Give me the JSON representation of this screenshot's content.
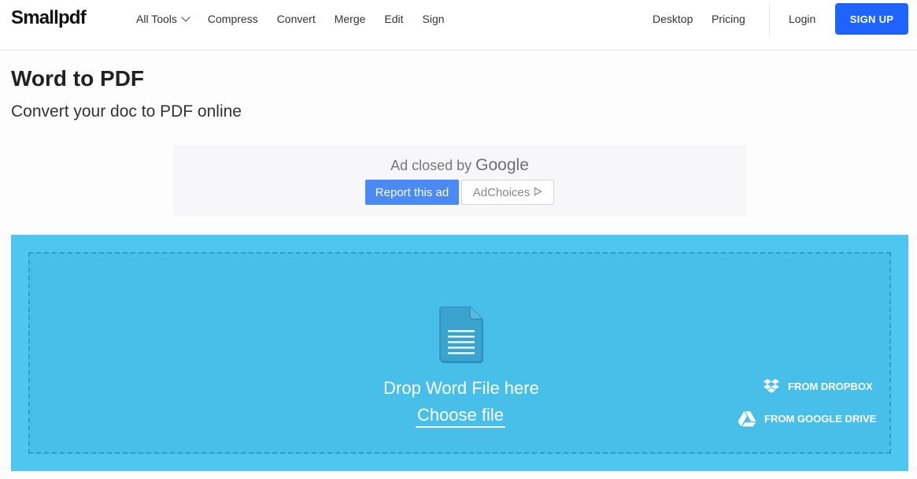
{
  "header": {
    "logo": "Smallpdf",
    "nav": [
      {
        "label": "All Tools",
        "has_dropdown": true
      },
      {
        "label": "Compress"
      },
      {
        "label": "Convert"
      },
      {
        "label": "Merge"
      },
      {
        "label": "Edit"
      },
      {
        "label": "Sign"
      }
    ],
    "desktop": "Desktop",
    "pricing": "Pricing",
    "login": "Login",
    "signup": "SIGN UP"
  },
  "main": {
    "title": "Word to PDF",
    "subtitle": "Convert your doc to PDF online"
  },
  "ad": {
    "closed_text": "Ad closed by",
    "google": "Google",
    "report": "Report this ad",
    "choices": "AdChoices"
  },
  "dropzone": {
    "drop_text": "Drop Word File here",
    "choose": "Choose file",
    "dropbox": "FROM DROPBOX",
    "gdrive": "FROM GOOGLE DRIVE"
  },
  "colors": {
    "accent": "#1f63ff",
    "dropzone_bg": "#4dc6f0",
    "dropzone_inner": "#47bfe9",
    "report_btn": "#4a8af4"
  },
  "icons": [
    "chevron-down-icon",
    "document-icon",
    "dropbox-icon",
    "google-drive-icon",
    "adchoices-icon"
  ]
}
